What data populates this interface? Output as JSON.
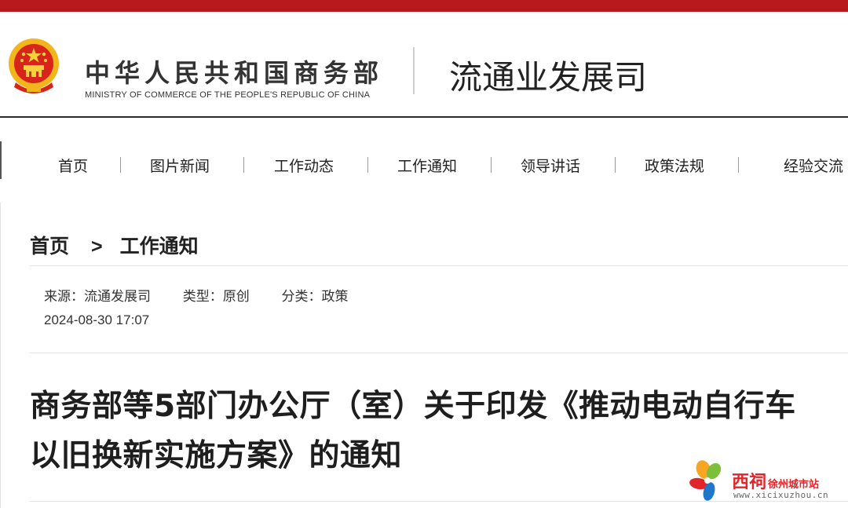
{
  "header": {
    "ministry_cn": "中华人民共和国商务部",
    "ministry_en": "MINISTRY OF COMMERCE OF THE PEOPLE'S REPUBLIC OF CHINA",
    "department": "流通业发展司",
    "emblem_icon": "national-emblem-icon"
  },
  "nav": {
    "items": [
      {
        "label": "首页"
      },
      {
        "label": "图片新闻"
      },
      {
        "label": "工作动态"
      },
      {
        "label": "工作通知"
      },
      {
        "label": "领导讲话"
      },
      {
        "label": "政策法规"
      },
      {
        "label": "经验交流"
      }
    ]
  },
  "breadcrumb": {
    "home": "首页",
    "separator": ">",
    "current": "工作通知"
  },
  "article": {
    "source": "来源：流通发展司",
    "type": "类型：原创",
    "category": "分类：政策",
    "date": "2024-08-30 17:07",
    "title": "商务部等5部门办公厅（室）关于印发《推动电动自行车以旧换新实施方案》的通知"
  },
  "watermark": {
    "name": "西祠",
    "subname": "徐州城市站",
    "url": "www.xicixuzhou.cn",
    "logo_icon": "pinwheel-logo-icon"
  },
  "colors": {
    "accent_red": "#b8191c",
    "watermark_red": "#e0262b"
  }
}
